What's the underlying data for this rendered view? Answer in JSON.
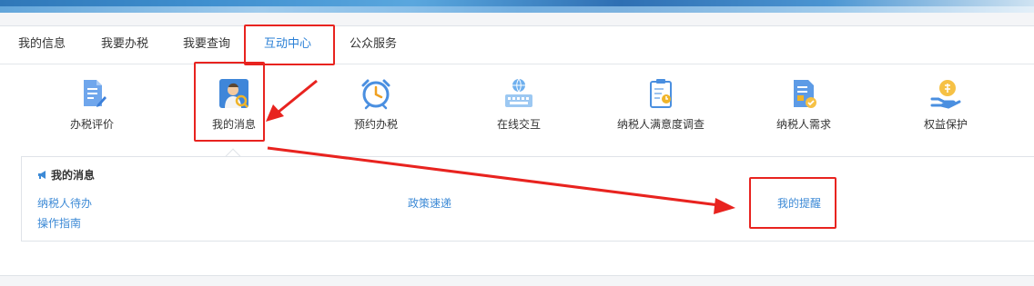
{
  "tabs": [
    {
      "label": "我的信息"
    },
    {
      "label": "我要办税"
    },
    {
      "label": "我要查询"
    },
    {
      "label": "互动中心",
      "active": true
    },
    {
      "label": "公众服务"
    }
  ],
  "functions": [
    {
      "label": "办税评价",
      "icon": "document-pen-icon"
    },
    {
      "label": "我的消息",
      "icon": "user-badge-icon"
    },
    {
      "label": "预约办税",
      "icon": "alarm-clock-icon"
    },
    {
      "label": "在线交互",
      "icon": "keyboard-globe-icon"
    },
    {
      "label": "纳税人满意度调查",
      "icon": "clipboard-survey-icon"
    },
    {
      "label": "纳税人需求",
      "icon": "document-check-icon"
    },
    {
      "label": "权益保护",
      "icon": "hand-coin-icon"
    }
  ],
  "submenu": {
    "title": "我的消息",
    "title_icon": "megaphone-icon",
    "links": [
      "纳税人待办",
      "政策速递",
      "我的提醒",
      "操作指南"
    ]
  },
  "annotation_color": "#e8231f",
  "accent_color": "#2b80d6",
  "link_color": "#3d8ad6"
}
